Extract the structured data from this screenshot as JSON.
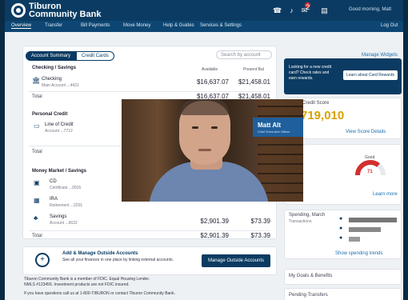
{
  "header": {
    "logo_line1": "Tiburon",
    "logo_line2": "Community Bank",
    "user_line": "Good morning, Matt",
    "icons": [
      "phone-icon",
      "bell-icon",
      "mail-icon",
      "document-icon"
    ],
    "mail_badge": "2"
  },
  "nav": {
    "items": [
      "Overview",
      "Transfer",
      "Bill Payments",
      "Move Money",
      "Help & Guides",
      "Services & Settings"
    ],
    "logout": "Log Out"
  },
  "accounts": {
    "segment_on": "Account Summary",
    "segment_off": "Credit Cards",
    "search_placeholder": "Search by account",
    "checking_title": "Checking / Savings",
    "col_available": "Available",
    "col_present": "Present Bal",
    "checking_name": "Checking",
    "checking_sub": "Main Account ...4431",
    "checking_available": "$16,637.07",
    "checking_present": "$21,458.01",
    "checking_total_label": "Total",
    "checking_total_available": "$16,637.07",
    "checking_total_present": "$21,458.01",
    "credit_title": "Personal Credit",
    "credit_name": "Line of Credit",
    "credit_sub": "Account ...7712",
    "credit_total_label": "Total",
    "moneymarket_title": "Money Market / Savings",
    "mm1_name": "CD",
    "mm1_sub": "Certificate ...0915",
    "mm2_name": "IRA",
    "mm2_sub": "Retirement ...2201",
    "mm3_name": "Savings",
    "mm3_sub": "Account ...6632",
    "mm3_available": "$2,901.39",
    "mm3_present": "$73.39",
    "mm_total_label": "Total",
    "mm_total_available": "$2,901.39",
    "mm_total_present": "$73.39"
  },
  "banner": {
    "title": "Add & Manage Outside Accounts",
    "text": "See all your finances in one place by linking external accounts.",
    "button": "Manage Outside Accounts"
  },
  "footer_text": {
    "line1": "Tiburon Community Bank is a member of FDIC. Equal Housing Lender.",
    "line2": "NMLS #123456. Investment products are not FDIC insured.",
    "line3": "If you have questions call us at 1-800-TIBURON or contact Tiburon Community Bank."
  },
  "right": {
    "manage_widgets": "Manage Widgets",
    "promo_text": "Looking for a new credit card? Check rates and earn rewards.",
    "promo_button": "Learn about Card Rewards",
    "score_title": "Credit Score",
    "score_value": "719,010",
    "score_link": "View Score Details",
    "gauge_label": "Good",
    "gauge_value": "71",
    "gauge_link": "Learn more",
    "spending_title": "Spending, March",
    "spending_sub": "Transactions",
    "spending_link": "Show spending trends",
    "goals_title": "My Goals & Benefits",
    "pending_title": "Pending Transfers"
  },
  "video": {
    "name": "Matt Alt",
    "subtitle": "Chief Executive Officer"
  },
  "colors": {
    "brand": "#0b3b62",
    "accent": "#1f5f9c",
    "score": "#d8a200",
    "gauge": "#d32f2f"
  }
}
